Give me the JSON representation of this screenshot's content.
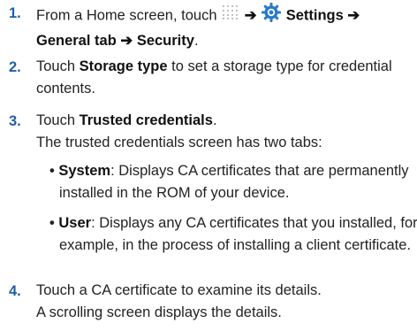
{
  "steps": [
    {
      "number": "1.",
      "lead": "From a Home screen, touch",
      "arrow": "➔",
      "settings_label": "Settings",
      "general_label": "General",
      "tab_word": "tab",
      "security_label": "Security",
      "period": "."
    },
    {
      "number": "2.",
      "touch": "Touch",
      "target": "Storage type",
      "rest_line1": "to set a storage type for credential",
      "rest_line2": "contents."
    },
    {
      "number": "3.",
      "touch": "Touch",
      "target": "Trusted credentials",
      "period": ".",
      "intro": "The trusted credentials screen has two tabs:",
      "bullets": [
        {
          "dot": "•",
          "term": "System",
          "line1": ": Displays CA certificates that are permanently",
          "line2": "installed in the ROM of your device."
        },
        {
          "dot": "•",
          "term": "User",
          "line1": ": Displays any CA certificates that you installed, for",
          "line2": "example, in the process of installing a client certificate."
        }
      ]
    },
    {
      "number": "4.",
      "line1": "Touch a CA certificate to examine its details.",
      "line2": "A scrolling screen displays the details."
    }
  ],
  "icons": {
    "apps": "apps-grid-icon",
    "settings": "settings-gear-icon"
  },
  "colors": {
    "step_number": "#1f5fa8",
    "gear": "#2a79c9",
    "text": "#222222"
  }
}
